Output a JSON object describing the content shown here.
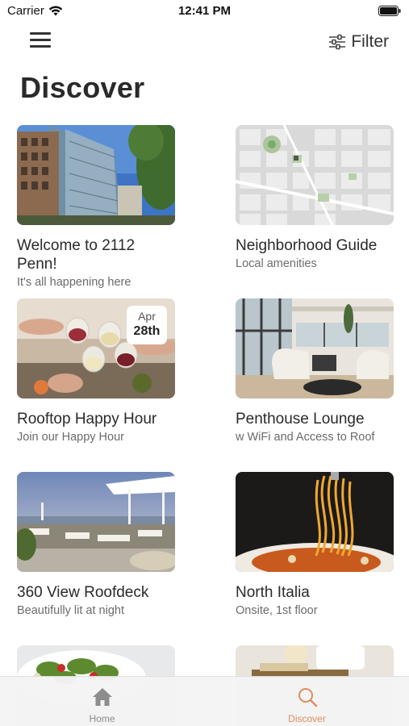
{
  "status_bar": {
    "carrier": "Carrier",
    "time": "12:41 PM"
  },
  "nav": {
    "filter_label": "Filter",
    "page_title": "Discover"
  },
  "accent_color": "#e0895a",
  "cards": [
    {
      "title": "Welcome to 2112 Penn!",
      "subtitle": "It's all happening here"
    },
    {
      "title": "Neighborhood Guide",
      "subtitle": "Local amenities"
    },
    {
      "title": "Rooftop Happy Hour",
      "subtitle": "Join our Happy Hour",
      "badge_month": "Apr",
      "badge_day": "28th"
    },
    {
      "title": "Penthouse Lounge",
      "subtitle": "w WiFi and Access to Roof"
    },
    {
      "title": "360 View Roofdeck",
      "subtitle": "Beautifully lit at night"
    },
    {
      "title": "North Italia",
      "subtitle": "Onsite, 1st floor"
    },
    {
      "title": "",
      "subtitle": ""
    },
    {
      "title": "",
      "subtitle": ""
    }
  ],
  "tabs": [
    {
      "label": "Home",
      "icon": "home-icon",
      "active": false
    },
    {
      "label": "Discover",
      "icon": "search-icon",
      "active": true
    }
  ]
}
